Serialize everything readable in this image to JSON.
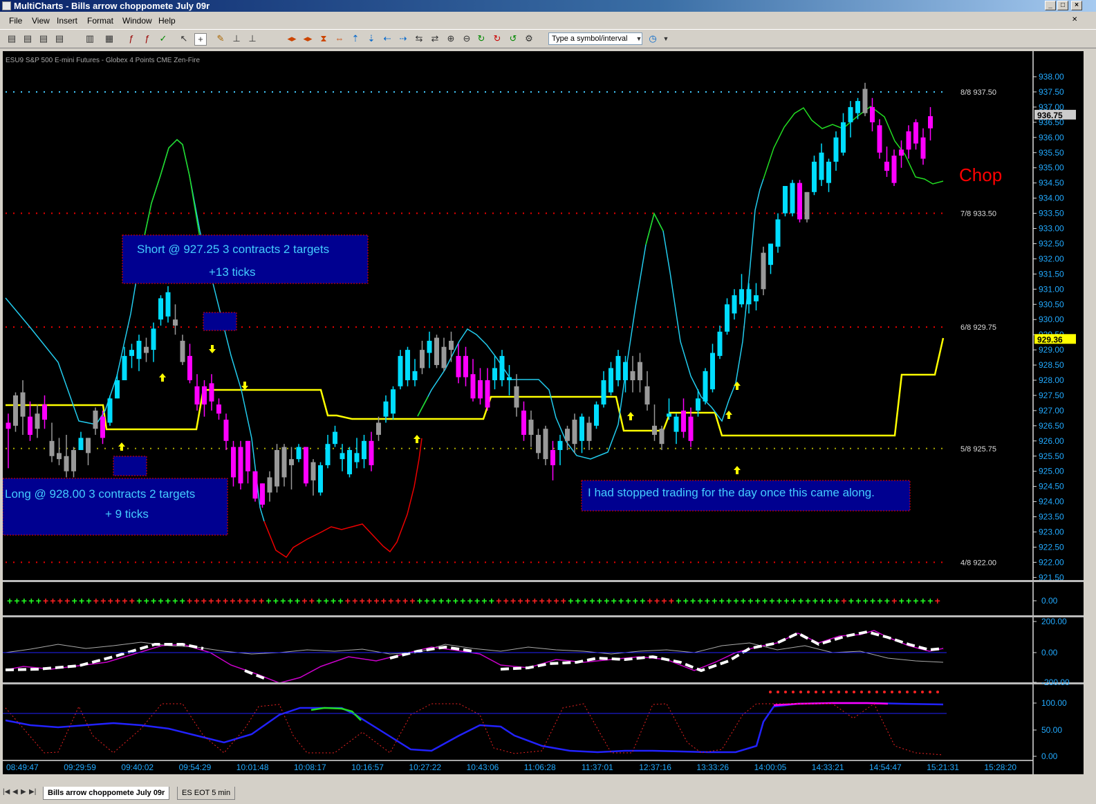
{
  "window": {
    "title": "MultiCharts - Bills arrow choppomete July 09r"
  },
  "menu": [
    "File",
    "View",
    "Insert",
    "Format",
    "Window",
    "Help"
  ],
  "toolbar": {
    "symbol_placeholder": "Type a symbol/interval"
  },
  "chart": {
    "header": "ESU9  S&P 500 E-mini Futures - Globex  4 Points  CME  Zen-Fire",
    "chop_label": "Chop",
    "price_axis": [
      "938.00",
      "937.50",
      "937.00",
      "936.50",
      "936.00",
      "935.50",
      "935.00",
      "934.50",
      "934.00",
      "933.50",
      "933.00",
      "932.50",
      "932.00",
      "931.50",
      "931.00",
      "930.50",
      "930.00",
      "929.50",
      "929.00",
      "928.50",
      "928.00",
      "927.50",
      "927.00",
      "926.50",
      "926.00",
      "925.50",
      "925.00",
      "924.50",
      "924.00",
      "923.50",
      "923.00",
      "922.50",
      "922.00",
      "921.50"
    ],
    "last_price": "936.75",
    "yellow_price": "929.36",
    "murrey_levels": [
      {
        "label": "8/8  937.50",
        "price": 937.5
      },
      {
        "label": "7/8  933.50",
        "price": 933.5
      },
      {
        "label": "6/8  929.75",
        "price": 929.75
      },
      {
        "label": "5/8  925.75",
        "price": 925.75
      },
      {
        "label": "4/8  922.00",
        "price": 922.0
      }
    ],
    "annotations": {
      "short_line1": "Short @ 927.25  3 contracts 2 targets",
      "short_line2": "+13  ticks",
      "long_line1": "Long @ 928.00   3 contracts 2 targets",
      "long_line2": "+ 9 ticks",
      "stopped": "I had stopped trading for the day once this came along."
    },
    "panel2_axis": [
      "0.00"
    ],
    "panel3_axis": [
      "200.00",
      "0.00",
      "-200.00"
    ],
    "panel4_axis": [
      "100.00",
      "50.00",
      "0.00"
    ],
    "time_axis": [
      "08:49:47",
      "09:29:59",
      "09:40:02",
      "09:54:29",
      "10:01:48",
      "10:08:17",
      "10:16:57",
      "10:27:22",
      "10:43:06",
      "11:06:28",
      "11:37:01",
      "12:37:16",
      "13:33:26",
      "14:00:05",
      "14:33:21",
      "14:54:47",
      "15:21:31",
      "15:28:20"
    ]
  },
  "chart_data": {
    "type": "candlestick",
    "bars": [
      {
        "o": 926.6,
        "h": 926.9,
        "l": 925.1,
        "c": 926.4,
        "col": "m"
      },
      {
        "o": 926.5,
        "h": 927.6,
        "l": 926.3,
        "c": 927.5,
        "col": "g"
      },
      {
        "o": 927.6,
        "h": 928.0,
        "l": 926.2,
        "c": 926.8,
        "col": "g"
      },
      {
        "o": 926.8,
        "h": 927.3,
        "l": 926.0,
        "c": 926.2,
        "col": "m"
      },
      {
        "o": 926.4,
        "h": 927.2,
        "l": 926.1,
        "c": 926.9,
        "col": "g"
      },
      {
        "o": 927.2,
        "h": 927.5,
        "l": 926.4,
        "c": 926.7,
        "col": "m"
      },
      {
        "o": 926.0,
        "h": 926.6,
        "l": 925.3,
        "c": 925.5,
        "col": "g"
      },
      {
        "o": 925.6,
        "h": 926.1,
        "l": 925.2,
        "c": 925.4,
        "col": "g"
      },
      {
        "o": 925.5,
        "h": 926.2,
        "l": 924.8,
        "c": 925.0,
        "col": "g"
      },
      {
        "o": 925.0,
        "h": 925.8,
        "l": 924.8,
        "c": 925.7,
        "col": "g"
      },
      {
        "o": 925.7,
        "h": 926.3,
        "l": 925.7,
        "c": 926.1,
        "col": "c"
      },
      {
        "o": 926.1,
        "h": 926.1,
        "l": 925.2,
        "c": 925.6,
        "col": "g"
      },
      {
        "o": 926.4,
        "h": 927.1,
        "l": 926.2,
        "c": 927.0,
        "col": "g"
      },
      {
        "o": 926.8,
        "h": 927.0,
        "l": 925.9,
        "c": 926.1,
        "col": "m"
      },
      {
        "o": 926.6,
        "h": 927.5,
        "l": 926.5,
        "c": 927.4,
        "col": "c"
      },
      {
        "o": 927.4,
        "h": 928.2,
        "l": 927.4,
        "c": 928.0,
        "col": "c"
      },
      {
        "o": 928.0,
        "h": 929.1,
        "l": 928.0,
        "c": 928.8,
        "col": "c"
      },
      {
        "o": 928.8,
        "h": 929.2,
        "l": 928.4,
        "c": 929.0,
        "col": "c"
      },
      {
        "o": 928.7,
        "h": 929.5,
        "l": 928.3,
        "c": 929.3,
        "col": "c"
      },
      {
        "o": 929.1,
        "h": 929.4,
        "l": 928.6,
        "c": 928.9,
        "col": "g"
      },
      {
        "o": 929.0,
        "h": 929.9,
        "l": 928.6,
        "c": 929.7,
        "col": "c"
      },
      {
        "o": 930.0,
        "h": 930.8,
        "l": 929.8,
        "c": 930.7,
        "col": "c"
      },
      {
        "o": 930.1,
        "h": 931.1,
        "l": 929.9,
        "c": 930.9,
        "col": "c"
      },
      {
        "o": 930.0,
        "h": 930.5,
        "l": 929.5,
        "c": 929.8,
        "col": "g"
      },
      {
        "o": 929.3,
        "h": 929.5,
        "l": 928.5,
        "c": 928.6,
        "col": "g"
      },
      {
        "o": 928.8,
        "h": 929.2,
        "l": 927.9,
        "c": 928.0,
        "col": "m"
      },
      {
        "o": 927.8,
        "h": 928.2,
        "l": 927.0,
        "c": 927.2,
        "col": "m"
      },
      {
        "o": 927.8,
        "h": 928.0,
        "l": 926.8,
        "c": 927.2,
        "col": "m"
      },
      {
        "o": 927.9,
        "h": 928.2,
        "l": 927.0,
        "c": 927.3,
        "col": "m"
      },
      {
        "o": 927.2,
        "h": 927.4,
        "l": 926.7,
        "c": 926.9,
        "col": "m"
      },
      {
        "o": 926.7,
        "h": 926.9,
        "l": 925.7,
        "c": 926.0,
        "col": "m"
      },
      {
        "o": 925.8,
        "h": 926.0,
        "l": 924.5,
        "c": 924.8,
        "col": "m"
      },
      {
        "o": 925.8,
        "h": 926.0,
        "l": 924.4,
        "c": 924.6,
        "col": "m"
      },
      {
        "o": 926.0,
        "h": 926.0,
        "l": 924.6,
        "c": 925.0,
        "col": "m"
      },
      {
        "o": 925.0,
        "h": 925.0,
        "l": 924.0,
        "c": 924.1,
        "col": "m"
      },
      {
        "o": 924.6,
        "h": 924.6,
        "l": 923.8,
        "c": 923.9,
        "col": "m"
      },
      {
        "o": 924.3,
        "h": 925.0,
        "l": 924.0,
        "c": 924.8,
        "col": "g"
      },
      {
        "o": 924.5,
        "h": 925.9,
        "l": 924.3,
        "c": 925.7,
        "col": "g"
      },
      {
        "o": 924.8,
        "h": 925.9,
        "l": 924.5,
        "c": 925.8,
        "col": "g"
      },
      {
        "o": 925.2,
        "h": 925.8,
        "l": 924.4,
        "c": 925.4,
        "col": "g"
      },
      {
        "o": 925.4,
        "h": 925.9,
        "l": 925.3,
        "c": 925.8,
        "col": "c"
      },
      {
        "o": 925.8,
        "h": 925.8,
        "l": 924.5,
        "c": 924.6,
        "col": "m"
      },
      {
        "o": 924.7,
        "h": 925.4,
        "l": 924.2,
        "c": 925.3,
        "col": "g"
      },
      {
        "o": 924.3,
        "h": 925.3,
        "l": 924.2,
        "c": 925.2,
        "col": "c"
      },
      {
        "o": 925.2,
        "h": 926.2,
        "l": 925.1,
        "c": 925.9,
        "col": "c"
      },
      {
        "o": 925.9,
        "h": 926.5,
        "l": 925.8,
        "c": 926.3,
        "col": "c"
      },
      {
        "o": 925.4,
        "h": 925.9,
        "l": 925.0,
        "c": 925.6,
        "col": "c"
      },
      {
        "o": 924.9,
        "h": 925.8,
        "l": 924.8,
        "c": 925.7,
        "col": "c"
      },
      {
        "o": 925.3,
        "h": 926.1,
        "l": 925.1,
        "c": 925.6,
        "col": "c"
      },
      {
        "o": 925.4,
        "h": 926.2,
        "l": 925.1,
        "c": 926.0,
        "col": "c"
      },
      {
        "o": 926.0,
        "h": 926.3,
        "l": 925.0,
        "c": 925.2,
        "col": "m"
      },
      {
        "o": 926.2,
        "h": 926.8,
        "l": 926.0,
        "c": 926.6,
        "col": "g"
      },
      {
        "o": 926.8,
        "h": 927.5,
        "l": 926.6,
        "c": 927.3,
        "col": "c"
      },
      {
        "o": 926.9,
        "h": 927.8,
        "l": 926.7,
        "c": 927.7,
        "col": "c"
      },
      {
        "o": 927.8,
        "h": 929.0,
        "l": 927.7,
        "c": 928.8,
        "col": "c"
      },
      {
        "o": 928.0,
        "h": 929.1,
        "l": 927.8,
        "c": 929.0,
        "col": "c"
      },
      {
        "o": 928.3,
        "h": 928.7,
        "l": 927.8,
        "c": 928.0,
        "col": "c"
      },
      {
        "o": 928.4,
        "h": 929.3,
        "l": 928.2,
        "c": 929.0,
        "col": "g"
      },
      {
        "o": 928.9,
        "h": 929.6,
        "l": 928.4,
        "c": 929.3,
        "col": "c"
      },
      {
        "o": 928.5,
        "h": 929.5,
        "l": 928.4,
        "c": 929.4,
        "col": "g"
      },
      {
        "o": 929.1,
        "h": 929.4,
        "l": 928.3,
        "c": 928.4,
        "col": "g"
      },
      {
        "o": 929.0,
        "h": 929.6,
        "l": 928.6,
        "c": 929.3,
        "col": "g"
      },
      {
        "o": 928.8,
        "h": 929.2,
        "l": 927.9,
        "c": 928.1,
        "col": "m"
      },
      {
        "o": 928.8,
        "h": 929.1,
        "l": 927.8,
        "c": 928.1,
        "col": "m"
      },
      {
        "o": 928.2,
        "h": 928.7,
        "l": 927.3,
        "c": 927.4,
        "col": "m"
      },
      {
        "o": 928.0,
        "h": 928.4,
        "l": 927.2,
        "c": 927.4,
        "col": "m"
      },
      {
        "o": 928.0,
        "h": 928.4,
        "l": 927.0,
        "c": 927.1,
        "col": "m"
      },
      {
        "o": 928.0,
        "h": 928.8,
        "l": 927.7,
        "c": 928.4,
        "col": "c"
      },
      {
        "o": 928.0,
        "h": 929.0,
        "l": 927.8,
        "c": 928.8,
        "col": "c"
      },
      {
        "o": 928.1,
        "h": 928.5,
        "l": 927.5,
        "c": 928.0,
        "col": "c"
      },
      {
        "o": 927.8,
        "h": 928.2,
        "l": 926.8,
        "c": 927.1,
        "col": "g"
      },
      {
        "o": 927.0,
        "h": 927.3,
        "l": 926.0,
        "c": 926.2,
        "col": "m"
      },
      {
        "o": 926.7,
        "h": 927.0,
        "l": 925.8,
        "c": 926.2,
        "col": "g"
      },
      {
        "o": 926.2,
        "h": 926.4,
        "l": 925.4,
        "c": 925.6,
        "col": "g"
      },
      {
        "o": 926.4,
        "h": 926.5,
        "l": 925.2,
        "c": 925.4,
        "col": "g"
      },
      {
        "o": 925.7,
        "h": 926.0,
        "l": 924.7,
        "c": 925.2,
        "col": "m"
      },
      {
        "o": 925.7,
        "h": 926.2,
        "l": 925.2,
        "c": 926.0,
        "col": "c"
      },
      {
        "o": 926.0,
        "h": 926.5,
        "l": 925.7,
        "c": 926.4,
        "col": "g"
      },
      {
        "o": 925.9,
        "h": 926.9,
        "l": 925.6,
        "c": 926.7,
        "col": "g"
      },
      {
        "o": 926.0,
        "h": 926.9,
        "l": 925.6,
        "c": 926.8,
        "col": "c"
      },
      {
        "o": 926.0,
        "h": 926.8,
        "l": 925.7,
        "c": 926.6,
        "col": "g"
      },
      {
        "o": 926.5,
        "h": 927.3,
        "l": 926.4,
        "c": 927.2,
        "col": "c"
      },
      {
        "o": 927.2,
        "h": 928.3,
        "l": 927.1,
        "c": 928.0,
        "col": "c"
      },
      {
        "o": 927.6,
        "h": 928.6,
        "l": 927.5,
        "c": 928.4,
        "col": "c"
      },
      {
        "o": 928.0,
        "h": 929.0,
        "l": 927.8,
        "c": 928.8,
        "col": "c"
      },
      {
        "o": 928.0,
        "h": 928.8,
        "l": 927.6,
        "c": 928.6,
        "col": "c"
      },
      {
        "o": 928.3,
        "h": 928.8,
        "l": 927.6,
        "c": 928.0,
        "col": "g"
      },
      {
        "o": 928.0,
        "h": 928.9,
        "l": 927.6,
        "c": 928.6,
        "col": "g"
      },
      {
        "o": 927.8,
        "h": 928.3,
        "l": 927.0,
        "c": 927.2,
        "col": "g"
      },
      {
        "o": 926.5,
        "h": 927.2,
        "l": 926.0,
        "c": 926.2,
        "col": "g"
      },
      {
        "o": 925.9,
        "h": 926.5,
        "l": 925.7,
        "c": 926.4,
        "col": "g"
      },
      {
        "o": 926.9,
        "h": 927.4,
        "l": 926.7,
        "c": 926.8,
        "col": "c"
      },
      {
        "o": 926.3,
        "h": 926.9,
        "l": 925.9,
        "c": 926.8,
        "col": "c"
      },
      {
        "o": 927.0,
        "h": 927.4,
        "l": 926.1,
        "c": 926.3,
        "col": "m"
      },
      {
        "o": 926.8,
        "h": 927.1,
        "l": 925.8,
        "c": 926.0,
        "col": "m"
      },
      {
        "o": 927.0,
        "h": 927.7,
        "l": 926.8,
        "c": 927.4,
        "col": "c"
      },
      {
        "o": 927.3,
        "h": 928.4,
        "l": 927.2,
        "c": 928.3,
        "col": "c"
      },
      {
        "o": 927.7,
        "h": 929.2,
        "l": 927.6,
        "c": 928.9,
        "col": "c"
      },
      {
        "o": 928.8,
        "h": 929.8,
        "l": 928.7,
        "c": 929.6,
        "col": "c"
      },
      {
        "o": 929.6,
        "h": 930.7,
        "l": 929.5,
        "c": 930.5,
        "col": "c"
      },
      {
        "o": 930.2,
        "h": 931.0,
        "l": 930.0,
        "c": 930.8,
        "col": "c"
      },
      {
        "o": 930.5,
        "h": 931.5,
        "l": 930.4,
        "c": 931.0,
        "col": "c"
      },
      {
        "o": 930.5,
        "h": 931.2,
        "l": 930.2,
        "c": 931.0,
        "col": "c"
      },
      {
        "o": 930.6,
        "h": 931.2,
        "l": 930.3,
        "c": 930.8,
        "col": "c"
      },
      {
        "o": 931.0,
        "h": 932.4,
        "l": 930.8,
        "c": 932.2,
        "col": "g"
      },
      {
        "o": 931.8,
        "h": 932.5,
        "l": 931.5,
        "c": 932.5,
        "col": "c"
      },
      {
        "o": 932.4,
        "h": 933.5,
        "l": 932.2,
        "c": 933.3,
        "col": "c"
      },
      {
        "o": 933.5,
        "h": 934.4,
        "l": 933.4,
        "c": 934.4,
        "col": "c"
      },
      {
        "o": 933.5,
        "h": 934.6,
        "l": 933.4,
        "c": 934.5,
        "col": "c"
      },
      {
        "o": 934.5,
        "h": 934.6,
        "l": 933.2,
        "c": 933.3,
        "col": "m"
      },
      {
        "o": 933.3,
        "h": 934.2,
        "l": 933.2,
        "c": 934.2,
        "col": "g"
      },
      {
        "o": 934.2,
        "h": 935.4,
        "l": 934.1,
        "c": 935.2,
        "col": "c"
      },
      {
        "o": 934.6,
        "h": 935.8,
        "l": 934.4,
        "c": 935.5,
        "col": "c"
      },
      {
        "o": 934.5,
        "h": 935.3,
        "l": 934.2,
        "c": 935.2,
        "col": "c"
      },
      {
        "o": 935.2,
        "h": 936.2,
        "l": 934.9,
        "c": 936.0,
        "col": "c"
      },
      {
        "o": 935.5,
        "h": 936.8,
        "l": 935.4,
        "c": 936.5,
        "col": "c"
      },
      {
        "o": 936.5,
        "h": 937.2,
        "l": 936.0,
        "c": 937.0,
        "col": "c"
      },
      {
        "o": 936.8,
        "h": 937.3,
        "l": 936.6,
        "c": 937.2,
        "col": "c"
      },
      {
        "o": 936.8,
        "h": 937.8,
        "l": 936.7,
        "c": 937.6,
        "col": "g"
      },
      {
        "o": 937.0,
        "h": 937.3,
        "l": 936.2,
        "c": 936.5,
        "col": "m"
      },
      {
        "o": 936.4,
        "h": 936.6,
        "l": 935.3,
        "c": 935.5,
        "col": "m"
      },
      {
        "o": 935.2,
        "h": 935.7,
        "l": 934.7,
        "c": 934.9,
        "col": "m"
      },
      {
        "o": 935.4,
        "h": 935.6,
        "l": 934.4,
        "c": 934.5,
        "col": "m"
      },
      {
        "o": 935.4,
        "h": 935.9,
        "l": 935.0,
        "c": 935.6,
        "col": "m"
      },
      {
        "o": 935.6,
        "h": 936.4,
        "l": 935.3,
        "c": 936.2,
        "col": "m"
      },
      {
        "o": 935.8,
        "h": 936.6,
        "l": 935.6,
        "c": 936.5,
        "col": "m"
      },
      {
        "o": 936.0,
        "h": 936.3,
        "l": 935.1,
        "c": 935.3,
        "col": "m"
      },
      {
        "o": 936.3,
        "h": 937.0,
        "l": 935.9,
        "c": 936.7,
        "col": "m"
      }
    ]
  }
}
